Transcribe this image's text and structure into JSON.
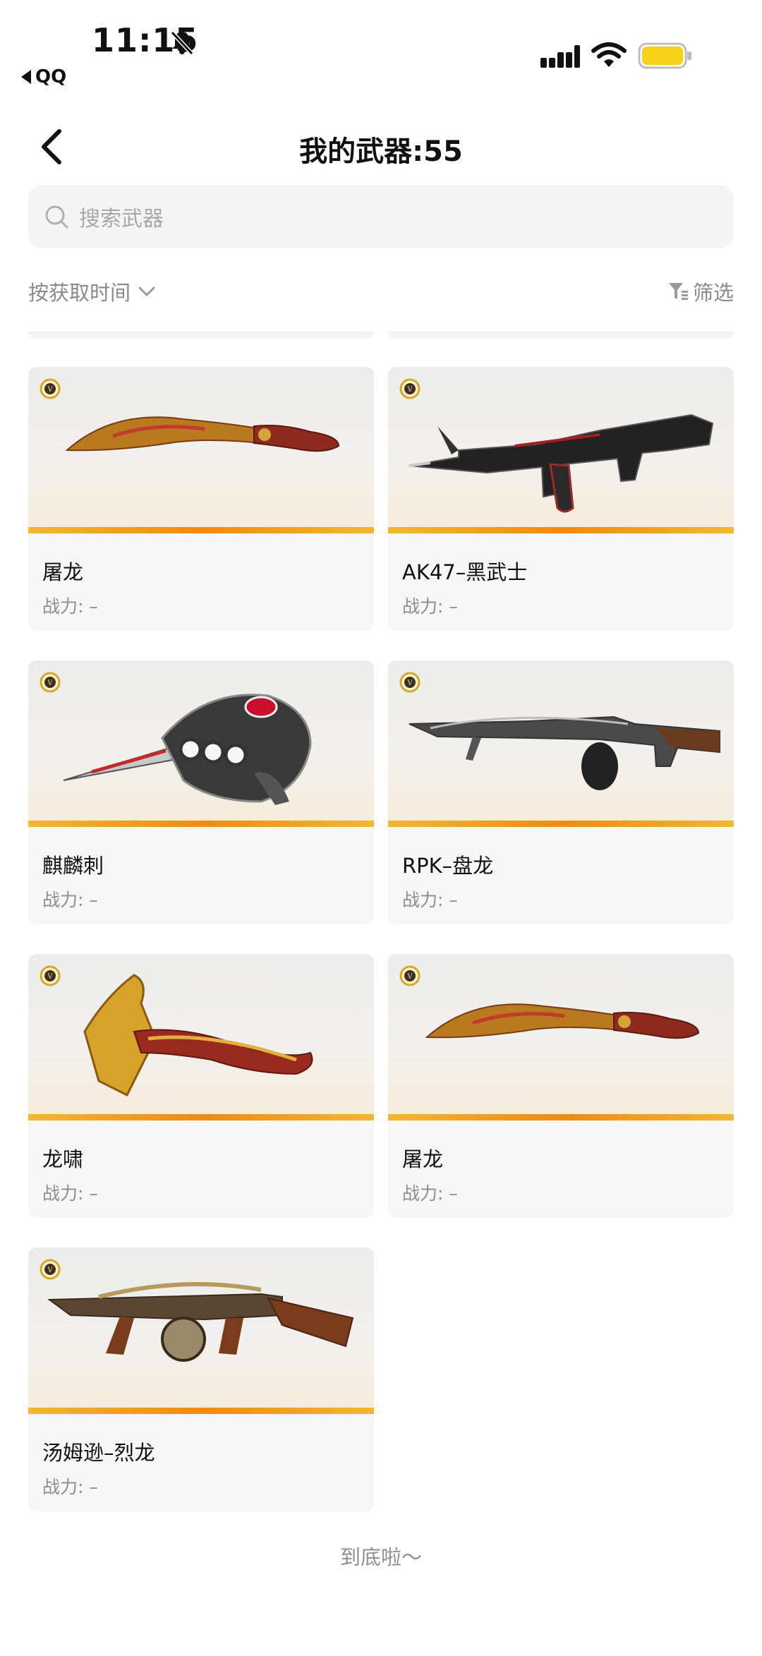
{
  "status_bar": {
    "time": "11:15",
    "back_app": "QQ",
    "battery_color": "#f7d117"
  },
  "header": {
    "title": "我的武器:55"
  },
  "search": {
    "placeholder": "搜索武器"
  },
  "sort": {
    "label": "按获取时间",
    "filter_label": "筛选"
  },
  "weapons": [
    {
      "name": "屠龙",
      "power": "战力: –",
      "icon": "kukri-knife"
    },
    {
      "name": "AK47–黑武士",
      "power": "战力: –",
      "icon": "rifle"
    },
    {
      "name": "麒麟刺",
      "power": "战力: –",
      "icon": "knuckle-dagger"
    },
    {
      "name": "RPK–盘龙",
      "power": "战力: –",
      "icon": "machine-gun"
    },
    {
      "name": "龙啸",
      "power": "战力: –",
      "icon": "axe"
    },
    {
      "name": "屠龙",
      "power": "战力: –",
      "icon": "kukri-knife"
    },
    {
      "name": "汤姆逊–烈龙",
      "power": "战力: –",
      "icon": "tommy-gun"
    }
  ],
  "footer": {
    "end_text": "到底啦～"
  },
  "colors": {
    "accent_stripe": "#f08a12",
    "card_bg": "#f6f6f6",
    "muted_text": "#8d8d8d"
  }
}
